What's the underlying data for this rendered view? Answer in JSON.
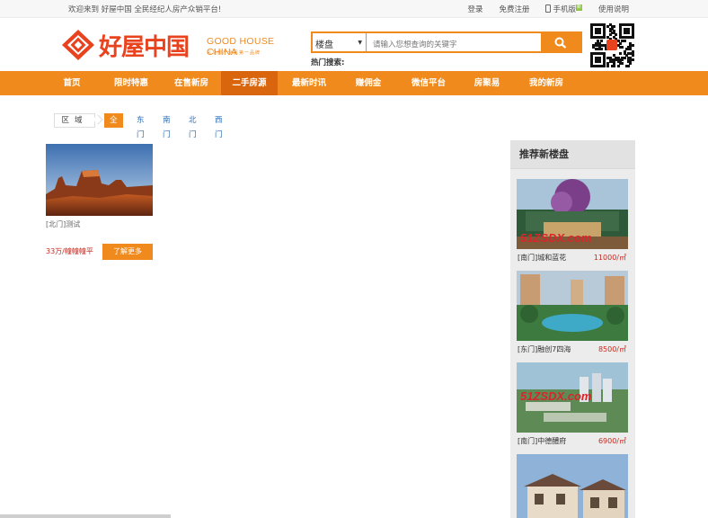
{
  "topbar": {
    "welcome": "欢迎来到 好屋中国 全民经纪人房产众销平台!",
    "login": "登录",
    "register": "免费注册",
    "mobile": "手机版",
    "mobile_badge": "新",
    "help": "使用说明"
  },
  "header": {
    "logo_cn": "好屋中国",
    "logo_en": "GOOD HOUSE CHINA",
    "logo_sub": "义乌房产全民第一品牌"
  },
  "search": {
    "category": "楼盘",
    "placeholder": "请输入您想查询的关键字",
    "hot_label": "热门搜索:"
  },
  "nav": {
    "items": [
      "首页",
      "限时特惠",
      "在售新房",
      "二手房源",
      "最新时讯",
      "赚佣金",
      "微信平台",
      "房聚易",
      "我的新房"
    ],
    "active": "二手房源"
  },
  "filter": {
    "label": "区域",
    "options": [
      "全部",
      "东门",
      "南门",
      "北门",
      "西门"
    ],
    "selected": "全部"
  },
  "listing": {
    "caption": "[北门]测试",
    "price": "33万/幢幢幢平",
    "more_button": "了解更多"
  },
  "sidebar": {
    "title": "推荐新楼盘",
    "items": [
      {
        "name": "[南门]城和蓝花",
        "price": "11000/㎡"
      },
      {
        "name": "[东门]融创7四海",
        "price": "8500/㎡"
      },
      {
        "name": "[南门]中德醴府",
        "price": "6900/㎡"
      },
      {
        "name": "",
        "price": ""
      }
    ],
    "watermark": "51ZSDX.com"
  },
  "colors": {
    "brand_orange": "#f08a1c",
    "nav_active": "#d9660c",
    "logo_red": "#e8421e",
    "price_red": "#c8281e",
    "link_blue": "#2a6db5"
  }
}
